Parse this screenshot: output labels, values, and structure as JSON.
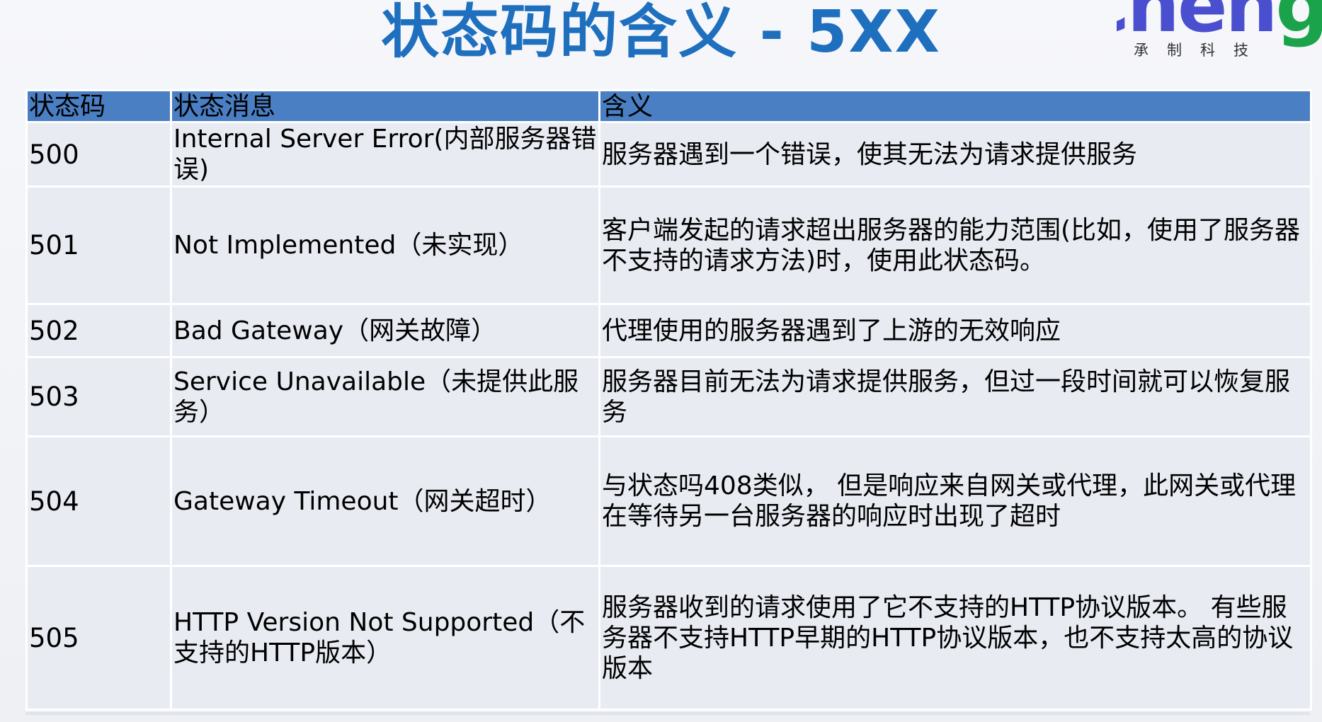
{
  "page": {
    "title": "状态码的含义 - 5XX"
  },
  "logo": {
    "word_main": "Chen",
    "word_accent": "g",
    "subtitle": "承制科技"
  },
  "table": {
    "headers": [
      "状态码",
      "状态消息",
      "含义"
    ],
    "rows": [
      {
        "code": "500",
        "message": "Internal Server Error(内部服务器错误)",
        "meaning": "服务器遇到一个错误，使其无法为请求提供服务"
      },
      {
        "code": "501",
        "message": "Not Implemented（未实现）",
        "meaning": "客户端发起的请求超出服务器的能力范围(比如，使用了服务器不支持的请求方法)时，使用此状态码。"
      },
      {
        "code": "502",
        "message": "Bad Gateway（网关故障）",
        "meaning": "代理使用的服务器遇到了上游的无效响应"
      },
      {
        "code": "503",
        "message": "Service Unavailable（未提供此服务）",
        "meaning": "服务器目前无法为请求提供服务，但过一段时间就可以恢复服务"
      },
      {
        "code": "504",
        "message": "Gateway Timeout（网关超时）",
        "meaning": "与状态吗408类似， 但是响应来自网关或代理，此网关或代理在等待另一台服务器的响应时出现了超时"
      },
      {
        "code": "505",
        "message": "HTTP Version Not Supported（不支持的HTTP版本）",
        "meaning": "服务器收到的请求使用了它不支持的HTTP协议版本。 有些服务器不支持HTTP早期的HTTP协议版本，也不支持太高的协议版本"
      }
    ]
  },
  "colors": {
    "title": "#1f6fbf",
    "header_bg": "#4a7fc4",
    "row_bg": "#e8ebf2"
  }
}
